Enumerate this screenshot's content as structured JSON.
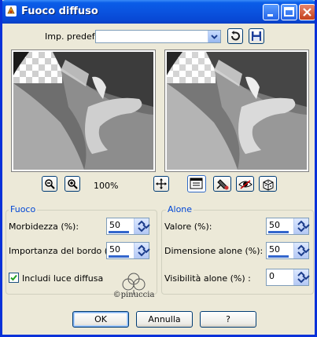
{
  "window": {
    "title": "Fuoco diffuso"
  },
  "presets": {
    "label": "Imp. predef.:",
    "value": ""
  },
  "zoom": {
    "level": "100%"
  },
  "fuoco": {
    "title": "Fuoco",
    "softness_label": "Morbidezza (%):",
    "softness_value": "50",
    "edge_label": "Importanza del bordo (%):",
    "edge_value": "50",
    "include_label": "Includi luce diffusa",
    "include_checked": true
  },
  "alone": {
    "title": "Alone",
    "value_label": "Valore (%):",
    "value_value": "50",
    "size_label": "Dimensione alone (%):",
    "size_value": "50",
    "visibility_label": "Visibilità alone (%) :",
    "visibility_value": "0"
  },
  "watermark_text": "©pinuccia",
  "buttons": {
    "ok": "OK",
    "cancel": "Annulla",
    "help": "?"
  },
  "colors": {
    "titlebar": "#0a54e0",
    "group_title": "#0046d5",
    "dialog_bg": "#ece9d8"
  }
}
